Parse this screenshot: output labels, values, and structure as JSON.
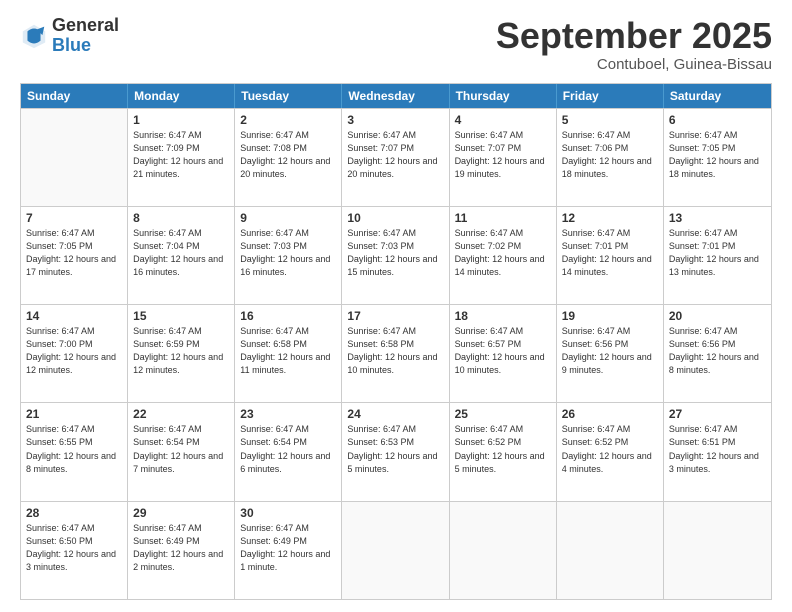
{
  "logo": {
    "general": "General",
    "blue": "Blue"
  },
  "header": {
    "month": "September 2025",
    "location": "Contuboel, Guinea-Bissau"
  },
  "days": [
    "Sunday",
    "Monday",
    "Tuesday",
    "Wednesday",
    "Thursday",
    "Friday",
    "Saturday"
  ],
  "weeks": [
    [
      {
        "day": "",
        "empty": true
      },
      {
        "day": "1",
        "sunrise": "Sunrise: 6:47 AM",
        "sunset": "Sunset: 7:09 PM",
        "daylight": "Daylight: 12 hours and 21 minutes."
      },
      {
        "day": "2",
        "sunrise": "Sunrise: 6:47 AM",
        "sunset": "Sunset: 7:08 PM",
        "daylight": "Daylight: 12 hours and 20 minutes."
      },
      {
        "day": "3",
        "sunrise": "Sunrise: 6:47 AM",
        "sunset": "Sunset: 7:07 PM",
        "daylight": "Daylight: 12 hours and 20 minutes."
      },
      {
        "day": "4",
        "sunrise": "Sunrise: 6:47 AM",
        "sunset": "Sunset: 7:07 PM",
        "daylight": "Daylight: 12 hours and 19 minutes."
      },
      {
        "day": "5",
        "sunrise": "Sunrise: 6:47 AM",
        "sunset": "Sunset: 7:06 PM",
        "daylight": "Daylight: 12 hours and 18 minutes."
      },
      {
        "day": "6",
        "sunrise": "Sunrise: 6:47 AM",
        "sunset": "Sunset: 7:05 PM",
        "daylight": "Daylight: 12 hours and 18 minutes."
      }
    ],
    [
      {
        "day": "7",
        "sunrise": "Sunrise: 6:47 AM",
        "sunset": "Sunset: 7:05 PM",
        "daylight": "Daylight: 12 hours and 17 minutes."
      },
      {
        "day": "8",
        "sunrise": "Sunrise: 6:47 AM",
        "sunset": "Sunset: 7:04 PM",
        "daylight": "Daylight: 12 hours and 16 minutes."
      },
      {
        "day": "9",
        "sunrise": "Sunrise: 6:47 AM",
        "sunset": "Sunset: 7:03 PM",
        "daylight": "Daylight: 12 hours and 16 minutes."
      },
      {
        "day": "10",
        "sunrise": "Sunrise: 6:47 AM",
        "sunset": "Sunset: 7:03 PM",
        "daylight": "Daylight: 12 hours and 15 minutes."
      },
      {
        "day": "11",
        "sunrise": "Sunrise: 6:47 AM",
        "sunset": "Sunset: 7:02 PM",
        "daylight": "Daylight: 12 hours and 14 minutes."
      },
      {
        "day": "12",
        "sunrise": "Sunrise: 6:47 AM",
        "sunset": "Sunset: 7:01 PM",
        "daylight": "Daylight: 12 hours and 14 minutes."
      },
      {
        "day": "13",
        "sunrise": "Sunrise: 6:47 AM",
        "sunset": "Sunset: 7:01 PM",
        "daylight": "Daylight: 12 hours and 13 minutes."
      }
    ],
    [
      {
        "day": "14",
        "sunrise": "Sunrise: 6:47 AM",
        "sunset": "Sunset: 7:00 PM",
        "daylight": "Daylight: 12 hours and 12 minutes."
      },
      {
        "day": "15",
        "sunrise": "Sunrise: 6:47 AM",
        "sunset": "Sunset: 6:59 PM",
        "daylight": "Daylight: 12 hours and 12 minutes."
      },
      {
        "day": "16",
        "sunrise": "Sunrise: 6:47 AM",
        "sunset": "Sunset: 6:58 PM",
        "daylight": "Daylight: 12 hours and 11 minutes."
      },
      {
        "day": "17",
        "sunrise": "Sunrise: 6:47 AM",
        "sunset": "Sunset: 6:58 PM",
        "daylight": "Daylight: 12 hours and 10 minutes."
      },
      {
        "day": "18",
        "sunrise": "Sunrise: 6:47 AM",
        "sunset": "Sunset: 6:57 PM",
        "daylight": "Daylight: 12 hours and 10 minutes."
      },
      {
        "day": "19",
        "sunrise": "Sunrise: 6:47 AM",
        "sunset": "Sunset: 6:56 PM",
        "daylight": "Daylight: 12 hours and 9 minutes."
      },
      {
        "day": "20",
        "sunrise": "Sunrise: 6:47 AM",
        "sunset": "Sunset: 6:56 PM",
        "daylight": "Daylight: 12 hours and 8 minutes."
      }
    ],
    [
      {
        "day": "21",
        "sunrise": "Sunrise: 6:47 AM",
        "sunset": "Sunset: 6:55 PM",
        "daylight": "Daylight: 12 hours and 8 minutes."
      },
      {
        "day": "22",
        "sunrise": "Sunrise: 6:47 AM",
        "sunset": "Sunset: 6:54 PM",
        "daylight": "Daylight: 12 hours and 7 minutes."
      },
      {
        "day": "23",
        "sunrise": "Sunrise: 6:47 AM",
        "sunset": "Sunset: 6:54 PM",
        "daylight": "Daylight: 12 hours and 6 minutes."
      },
      {
        "day": "24",
        "sunrise": "Sunrise: 6:47 AM",
        "sunset": "Sunset: 6:53 PM",
        "daylight": "Daylight: 12 hours and 5 minutes."
      },
      {
        "day": "25",
        "sunrise": "Sunrise: 6:47 AM",
        "sunset": "Sunset: 6:52 PM",
        "daylight": "Daylight: 12 hours and 5 minutes."
      },
      {
        "day": "26",
        "sunrise": "Sunrise: 6:47 AM",
        "sunset": "Sunset: 6:52 PM",
        "daylight": "Daylight: 12 hours and 4 minutes."
      },
      {
        "day": "27",
        "sunrise": "Sunrise: 6:47 AM",
        "sunset": "Sunset: 6:51 PM",
        "daylight": "Daylight: 12 hours and 3 minutes."
      }
    ],
    [
      {
        "day": "28",
        "sunrise": "Sunrise: 6:47 AM",
        "sunset": "Sunset: 6:50 PM",
        "daylight": "Daylight: 12 hours and 3 minutes."
      },
      {
        "day": "29",
        "sunrise": "Sunrise: 6:47 AM",
        "sunset": "Sunset: 6:49 PM",
        "daylight": "Daylight: 12 hours and 2 minutes."
      },
      {
        "day": "30",
        "sunrise": "Sunrise: 6:47 AM",
        "sunset": "Sunset: 6:49 PM",
        "daylight": "Daylight: 12 hours and 1 minute."
      },
      {
        "day": "",
        "empty": true
      },
      {
        "day": "",
        "empty": true
      },
      {
        "day": "",
        "empty": true
      },
      {
        "day": "",
        "empty": true
      }
    ]
  ]
}
